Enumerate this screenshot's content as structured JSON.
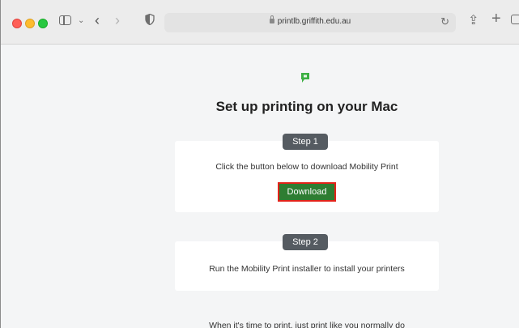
{
  "browser": {
    "url": "printlb.griffith.edu.au"
  },
  "page": {
    "title": "Set up printing on your Mac",
    "step1": {
      "label": "Step 1",
      "text": "Click the button below to download Mobility Print",
      "button": "Download"
    },
    "step2": {
      "label": "Step 2",
      "text": "Run the Mobility Print installer to install your printers"
    },
    "footer": "When it's time to print, just print like you normally do"
  },
  "colors": {
    "download_button": "#2e7d32",
    "highlight_border": "#e2231a",
    "logo": "#3cb043"
  }
}
